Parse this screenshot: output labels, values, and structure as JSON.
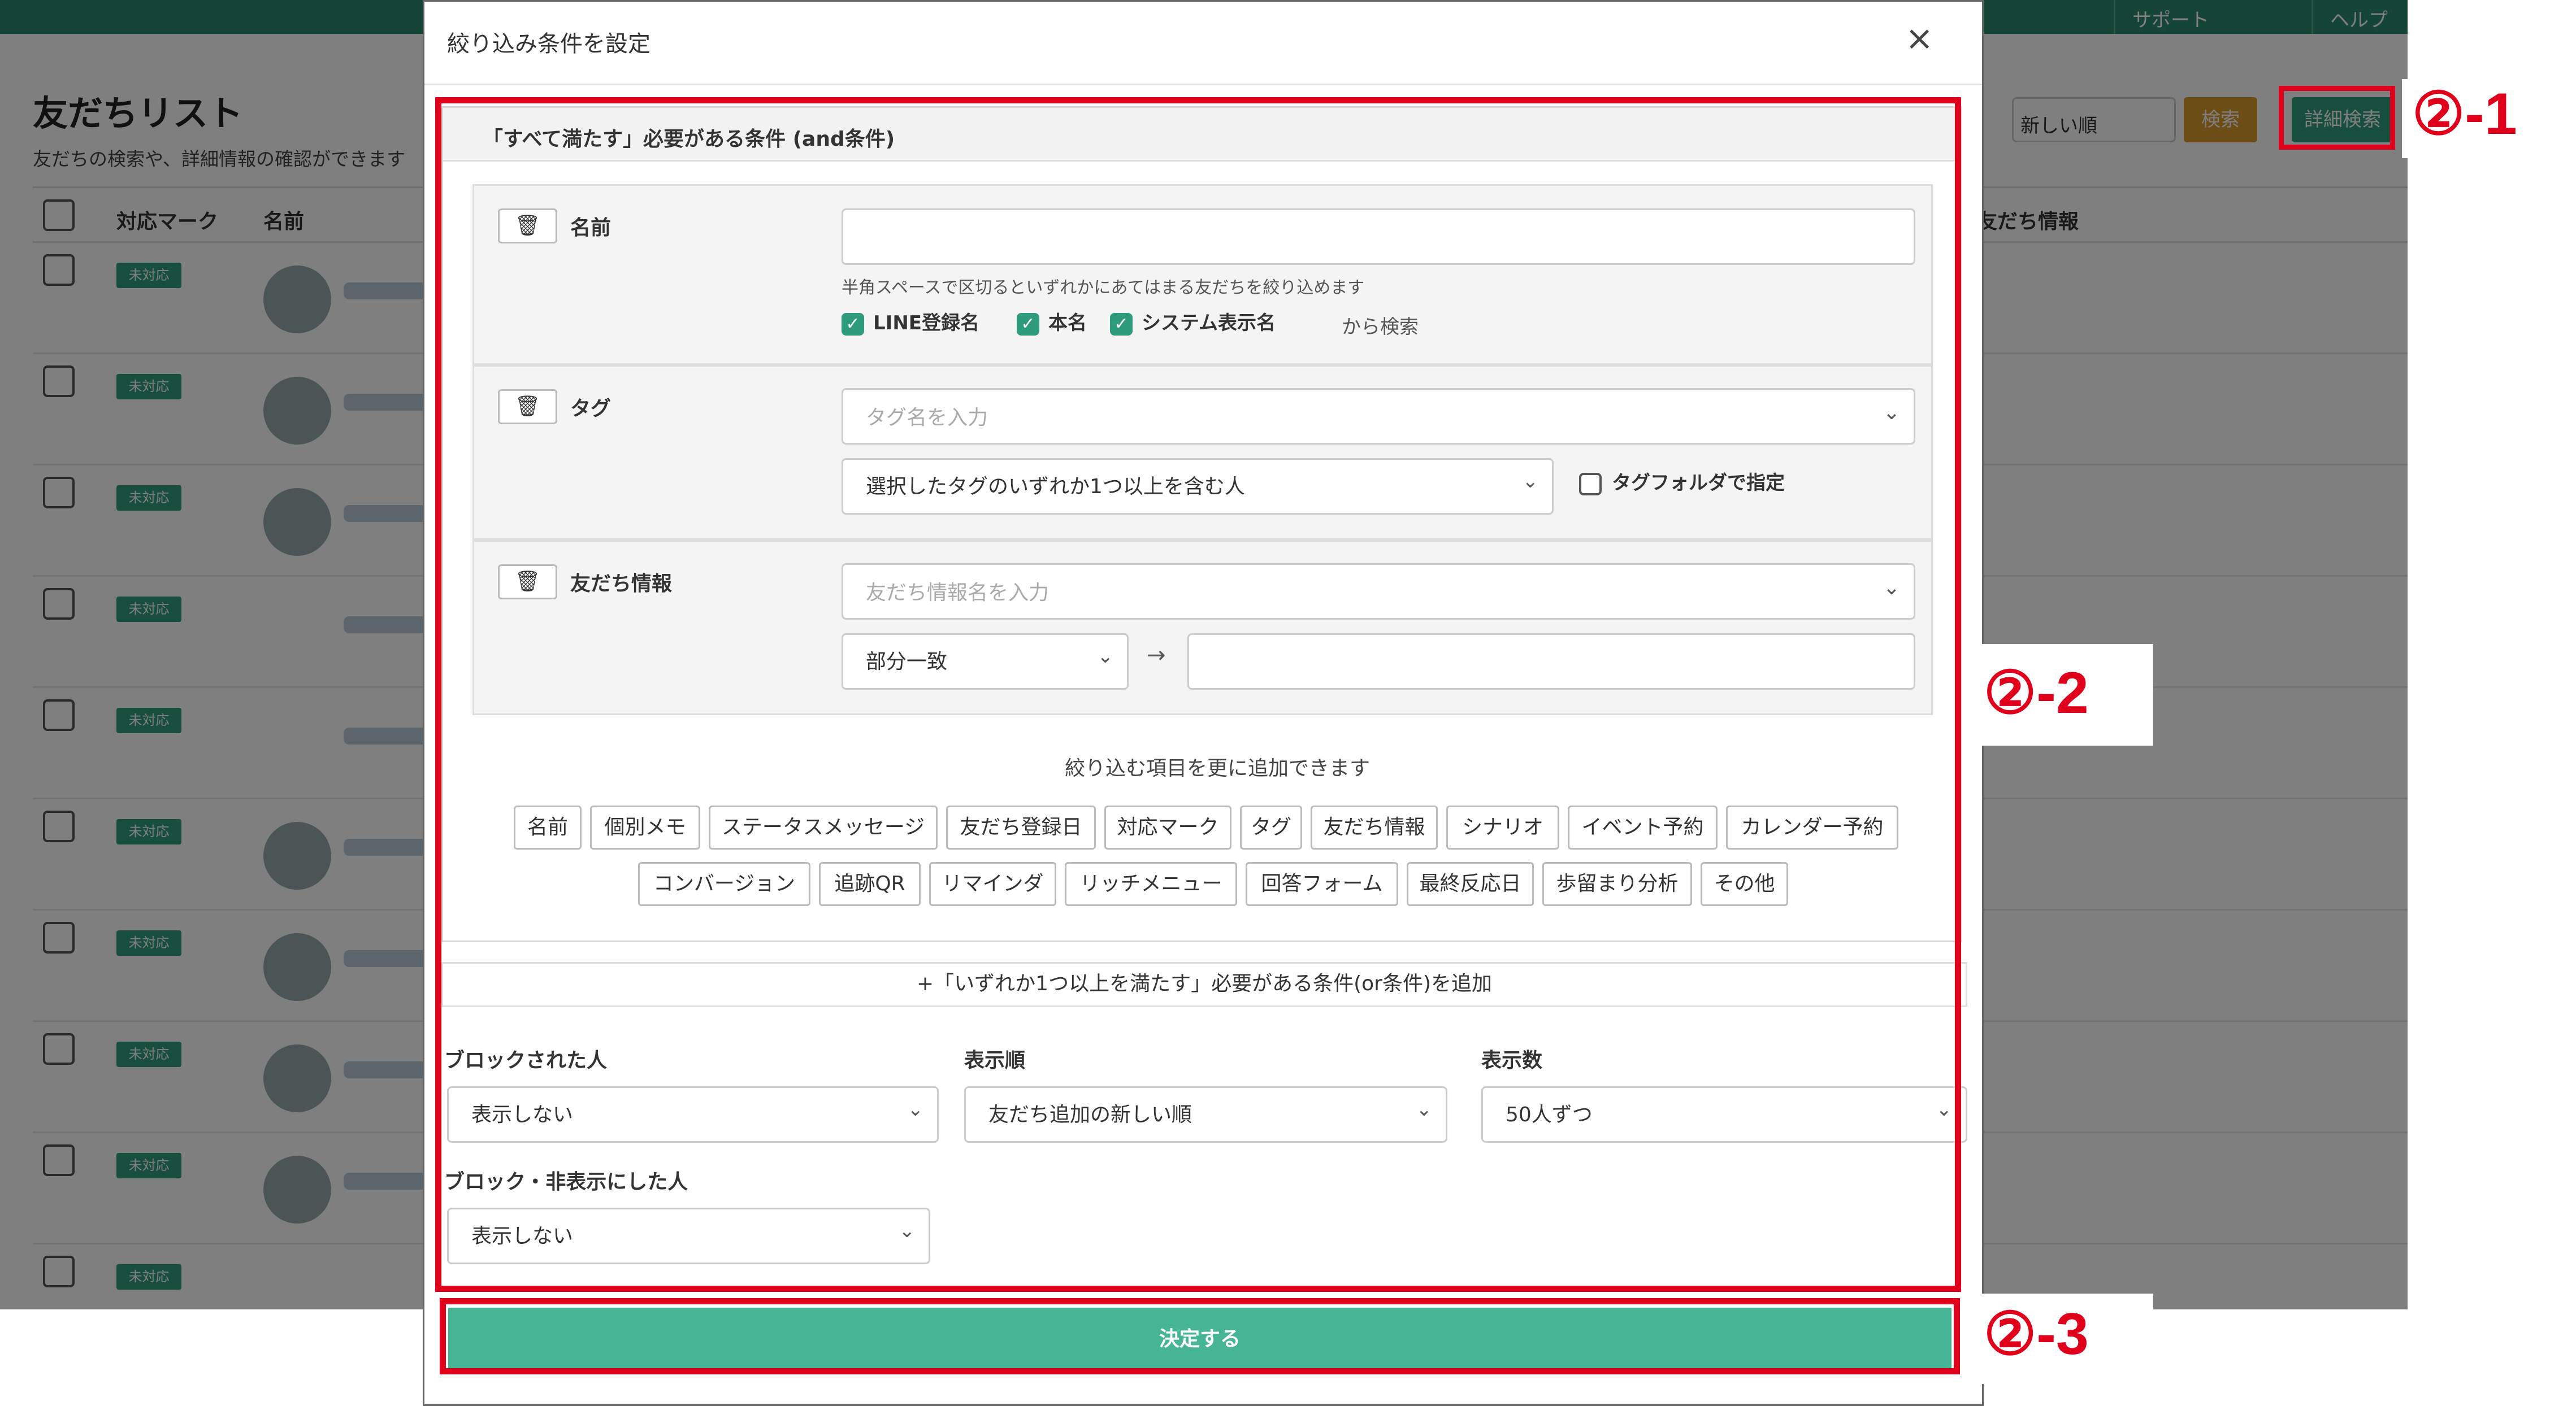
{
  "background": {
    "topbar": {
      "item1": "サポート",
      "item2": "ヘルプ"
    },
    "title": "友だちリスト",
    "subtitle": "友だちの検索や、詳細情報の確認ができます",
    "sort_label": "新しい順",
    "search_label": "検索",
    "advanced_label": "詳細検索",
    "columns": {
      "mark": "対応マーク",
      "name": "名前",
      "info": "友だち情報"
    },
    "row_mark": "未対応"
  },
  "modal": {
    "title": "絞り込み条件を設定",
    "close": "×",
    "and_header": "「すべて満たす」必要がある条件 (and条件)",
    "name_panel": {
      "label": "名前",
      "hint": "半角スペースで区切るといずれかにあてはまる友だちを絞り込めます",
      "checks": [
        "LINE登録名",
        "本名",
        "システム表示名"
      ],
      "suffix": "から検索"
    },
    "tag_panel": {
      "label": "タグ",
      "placeholder": "タグ名を入力",
      "match_select": "選択したタグのいずれか1つ以上を含む人",
      "folder_check": "タグフォルダで指定"
    },
    "info_panel": {
      "label": "友だち情報",
      "placeholder": "友だち情報名を入力",
      "match_select": "部分一致",
      "arrow": "→"
    },
    "add_more_text": "絞り込む項目を更に追加できます",
    "chips_row1": [
      "名前",
      "個別メモ",
      "ステータスメッセージ",
      "友だち登録日",
      "対応マーク",
      "タグ",
      "友だち情報",
      "シナリオ",
      "イベント予約",
      "カレンダー予約"
    ],
    "chips_row2": [
      "コンバージョン",
      "追跡QR",
      "リマインダ",
      "リッチメニュー",
      "回答フォーム",
      "最終反応日",
      "歩留まり分析",
      "その他"
    ],
    "or_add": "+「いずれか1つ以上を満たす」必要がある条件(or条件)を追加",
    "blocked": {
      "label": "ブロックされた人",
      "value": "表示しない"
    },
    "order": {
      "label": "表示順",
      "value": "友だち追加の新しい順"
    },
    "count": {
      "label": "表示数",
      "value": "50人ずつ"
    },
    "hidden": {
      "label": "ブロック・非表示にした人",
      "value": "表示しない"
    },
    "submit": "決定する"
  },
  "annotations": {
    "a1": "②-1",
    "a2": "②-2",
    "a3": "②-3"
  },
  "colors": {
    "accent": "#2e9c7c",
    "highlight": "#e0001b",
    "submit": "#45b595"
  }
}
